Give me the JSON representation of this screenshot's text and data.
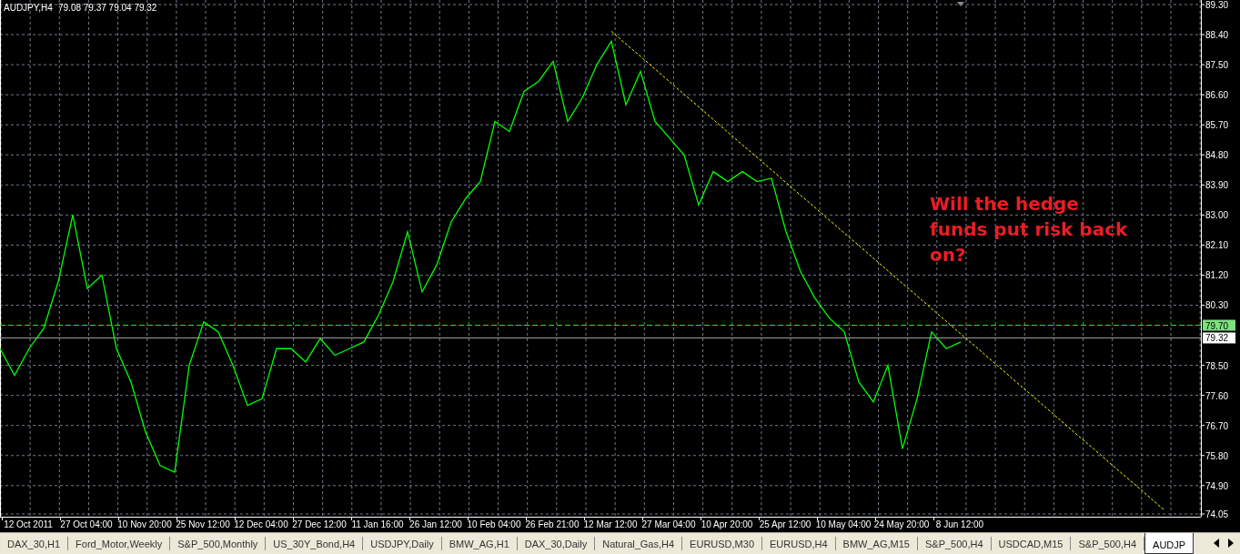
{
  "chart_header": {
    "symbol": "AUDJPY,H4",
    "ohlc": "79.08 79.37 79.04 79.32"
  },
  "chart_data": {
    "type": "line",
    "grid": true,
    "categories": [
      null,
      null,
      "12 Oct 2011",
      null,
      null,
      null,
      "27 Oct 04:00",
      null,
      null,
      null,
      "10 Nov 20:00",
      null,
      null,
      null,
      "25 Nov 12:00",
      null,
      null,
      null,
      "12 Dec 04:00",
      null,
      null,
      null,
      "27 Dec 12:00",
      null,
      null,
      null,
      "11 Jan 16:00",
      null,
      null,
      null,
      "26 Jan 12:00",
      null,
      null,
      null,
      "10 Feb 04:00",
      null,
      null,
      null,
      "26 Feb 21:00",
      null,
      null,
      null,
      "12 Mar 12:00",
      null,
      null,
      null,
      "27 Mar 04:00",
      null,
      null,
      null,
      "10 Apr 20:00",
      null,
      null,
      null,
      "25 Apr 12:00",
      null,
      null,
      null,
      "10 May 04:00",
      null,
      null,
      null,
      "24 May 20:00",
      null,
      null,
      null,
      "8 Jun 12:00",
      null,
      null,
      null,
      null,
      null,
      null,
      null,
      null,
      null,
      null,
      null,
      null,
      null,
      null
    ],
    "series": [
      {
        "color": "#00ff00",
        "values": [
          79.0,
          78.2,
          79.0,
          79.6,
          81.0,
          83.0,
          80.8,
          81.2,
          79.0,
          78.0,
          76.5,
          75.5,
          75.3,
          78.5,
          79.8,
          79.5,
          78.5,
          77.3,
          77.5,
          79.0,
          79.0,
          78.6,
          79.3,
          78.8,
          79.0,
          79.2,
          80.0,
          81.0,
          82.5,
          80.7,
          81.5,
          82.8,
          83.5,
          84.0,
          85.8,
          85.5,
          86.7,
          87.0,
          87.6,
          85.8,
          86.5,
          87.5,
          88.2,
          86.3,
          87.3,
          85.8,
          85.3,
          84.8,
          83.3,
          84.3,
          84.0,
          84.3,
          84.0,
          84.1,
          82.5,
          81.3,
          80.5,
          79.9,
          79.5,
          78.0,
          77.4,
          78.5,
          76.0,
          77.5,
          79.5,
          79.0,
          79.2,
          null,
          null,
          null,
          null,
          null,
          null,
          null,
          null,
          null,
          null,
          null,
          null,
          null,
          null
        ]
      },
      {
        "color": "#ffff00",
        "line_style": "dashed",
        "values": [
          null,
          null,
          null,
          null,
          null,
          null,
          null,
          null,
          null,
          null,
          null,
          null,
          null,
          null,
          null,
          null,
          null,
          null,
          null,
          null,
          null,
          null,
          null,
          null,
          null,
          null,
          null,
          null,
          null,
          null,
          null,
          null,
          null,
          null,
          null,
          null,
          null,
          null,
          null,
          null,
          null,
          null,
          88.5,
          88.12,
          87.75,
          87.37,
          86.99,
          86.61,
          86.24,
          85.86,
          85.48,
          85.1,
          84.73,
          84.35,
          83.97,
          83.59,
          83.22,
          82.84,
          82.46,
          82.09,
          81.71,
          81.33,
          80.95,
          80.58,
          80.2,
          79.82,
          79.44,
          79.07,
          78.69,
          78.31,
          77.93,
          77.56,
          77.18,
          76.8,
          76.42,
          76.05,
          75.67,
          75.29,
          74.92,
          74.54,
          74.16
        ]
      }
    ],
    "ylim": [
      74.05,
      89.3
    ],
    "yticks": [
      {
        "value": 89.3,
        "label": "89.30"
      },
      {
        "value": 88.4,
        "label": "88.40"
      },
      {
        "value": 87.5,
        "label": "87.50"
      },
      {
        "value": 86.6,
        "label": "86.60"
      },
      {
        "value": 85.7,
        "label": "85.70"
      },
      {
        "value": 84.8,
        "label": "84.80"
      },
      {
        "value": 83.9,
        "label": "83.90"
      },
      {
        "value": 83.0,
        "label": "83.00"
      },
      {
        "value": 82.1,
        "label": "82.10"
      },
      {
        "value": 81.2,
        "label": "81.20"
      },
      {
        "value": 80.3,
        "label": "80.30"
      },
      {
        "value": 78.5,
        "label": "78.50"
      },
      {
        "value": 77.6,
        "label": "77.60"
      },
      {
        "value": 76.7,
        "label": "76.70"
      },
      {
        "value": 75.8,
        "label": "75.80"
      },
      {
        "value": 74.9,
        "label": "74.90"
      },
      {
        "value": 74.05,
        "label": "74.05"
      }
    ],
    "ref_lines": [
      {
        "axis": "y",
        "value": 79.7,
        "label": "79.70",
        "color": "#00ff00"
      },
      {
        "axis": "y",
        "value": 79.32,
        "label": "79.32",
        "color": "#a0a0a0"
      }
    ],
    "annotations": [
      "Will the hedge funds put risk back on?"
    ]
  },
  "tabs": [
    {
      "label": "DAX_30,H1",
      "selected": false
    },
    {
      "label": "Ford_Motor,Weekly",
      "selected": false
    },
    {
      "label": "S&P_500,Monthly",
      "selected": false
    },
    {
      "label": "US_30Y_Bond,H4",
      "selected": false
    },
    {
      "label": "USDJPY,Daily",
      "selected": false
    },
    {
      "label": "BMW_AG,H1",
      "selected": false
    },
    {
      "label": "DAX_30,Daily",
      "selected": false
    },
    {
      "label": "Natural_Gas,H4",
      "selected": false
    },
    {
      "label": "EURUSD,M30",
      "selected": false
    },
    {
      "label": "EURUSD,H4",
      "selected": false
    },
    {
      "label": "BMW_AG,M15",
      "selected": false
    },
    {
      "label": "S&P_500,H4",
      "selected": false
    },
    {
      "label": "USDCAD,M15",
      "selected": false
    },
    {
      "label": "S&P_500,H4",
      "selected": false
    },
    {
      "label": "AUDJP",
      "selected": true
    }
  ]
}
